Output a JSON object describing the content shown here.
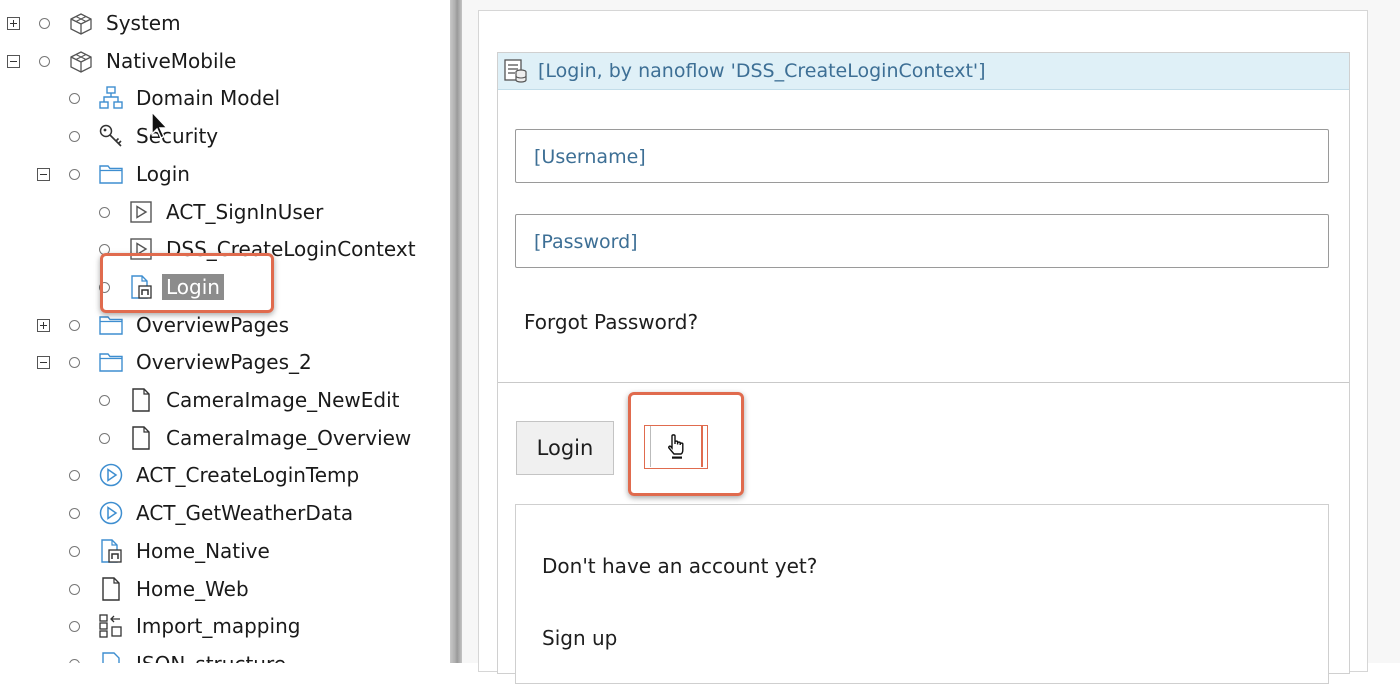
{
  "tree": {
    "items": [
      {
        "label": "System",
        "icon": "module-icon",
        "expander": "plus"
      },
      {
        "label": "NativeMobile",
        "icon": "module-icon",
        "expander": "minus"
      },
      {
        "label": "Domain Model",
        "icon": "domain-model-icon",
        "expander": ""
      },
      {
        "label": "Security",
        "icon": "key-icon",
        "expander": ""
      },
      {
        "label": "Login",
        "icon": "folder-icon",
        "expander": "minus"
      },
      {
        "label": "ACT_SignInUser",
        "icon": "nanoflow-icon",
        "expander": ""
      },
      {
        "label": "DSS_CreateLoginContext",
        "icon": "nanoflow-icon",
        "expander": ""
      },
      {
        "label": "Login",
        "icon": "native-page-icon",
        "expander": "",
        "selected": true
      },
      {
        "label": "OverviewPages",
        "icon": "folder-icon",
        "expander": "plus"
      },
      {
        "label": "OverviewPages_2",
        "icon": "folder-icon",
        "expander": "minus"
      },
      {
        "label": "CameraImage_NewEdit",
        "icon": "page-icon",
        "expander": ""
      },
      {
        "label": "CameraImage_Overview",
        "icon": "page-icon",
        "expander": ""
      },
      {
        "label": "ACT_CreateLoginTemp",
        "icon": "microflow-icon",
        "expander": ""
      },
      {
        "label": "ACT_GetWeatherData",
        "icon": "microflow-icon",
        "expander": ""
      },
      {
        "label": "Home_Native",
        "icon": "native-page-icon",
        "expander": ""
      },
      {
        "label": "Home_Web",
        "icon": "page-icon",
        "expander": ""
      },
      {
        "label": "Import_mapping",
        "icon": "import-mapping-icon",
        "expander": ""
      },
      {
        "label": "JSON_structure",
        "icon": "json-icon",
        "expander": ""
      }
    ]
  },
  "dataview": {
    "header": "[Login, by nanoflow 'DSS_CreateLoginContext']",
    "header_icon": "data-view-icon",
    "username_placeholder": "[Username]",
    "password_placeholder": "[Password]",
    "forgot_label": "Forgot Password?",
    "login_button": "Login",
    "empty_button_icon": "hand-pointer-icon",
    "signup_question": "Don't have an account yet?",
    "signup_label": "Sign up"
  },
  "colors": {
    "highlight": "#e06b4e",
    "header_bg": "#dff0f7",
    "header_text": "#3d6f95",
    "selection": "#8c8c8c",
    "icon_blue": "#3e8ed0"
  }
}
